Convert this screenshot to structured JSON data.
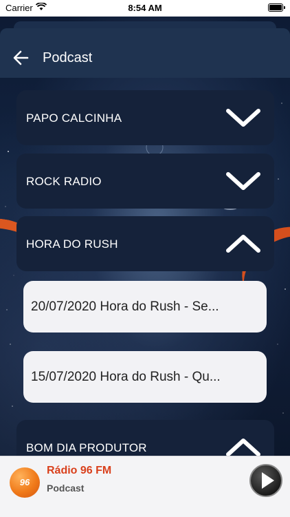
{
  "status_bar": {
    "carrier": "Carrier",
    "time": "8:54 AM"
  },
  "header": {
    "title": "Podcast",
    "back_icon": "arrow-left-icon"
  },
  "accordion": [
    {
      "label": "PAPO CALCINHA",
      "expanded": false
    },
    {
      "label": "ROCK RADIO",
      "expanded": false
    },
    {
      "label": "HORA DO RUSH",
      "expanded": true,
      "episodes": [
        {
          "label": "20/07/2020 Hora do Rush - Se..."
        },
        {
          "label": "15/07/2020 Hora do Rush - Qu..."
        }
      ]
    },
    {
      "label": "BOM DIA PRODUTOR",
      "expanded": true
    }
  ],
  "player": {
    "logo_text": "96",
    "station": "Rádio 96 FM",
    "subtitle": "Podcast",
    "play_icon": "play-icon"
  },
  "colors": {
    "header_bg": "#1f3350",
    "card_bg": "#15223a",
    "episode_bg": "#f2f2f5",
    "accent_orange": "#e65a1e",
    "station_red": "#d9401c"
  }
}
